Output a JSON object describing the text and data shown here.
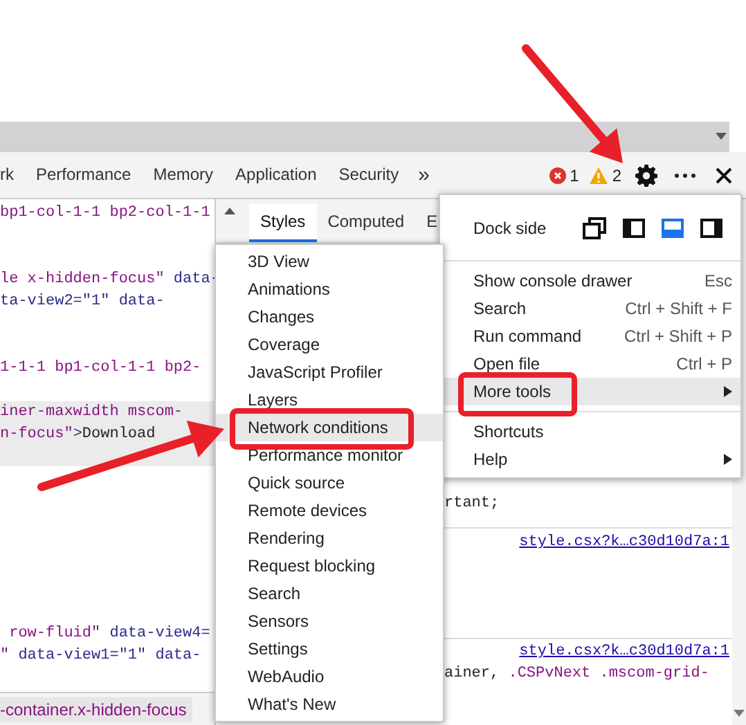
{
  "tabs": [
    {
      "label": "rk",
      "selected": false
    },
    {
      "label": "Performance",
      "selected": false
    },
    {
      "label": "Memory",
      "selected": false
    },
    {
      "label": "Application",
      "selected": false
    },
    {
      "label": "Security",
      "selected": false
    }
  ],
  "more_tabs": "»",
  "counters": {
    "errors": "1",
    "warnings": "2"
  },
  "elements": {
    "lines": [
      {
        "selected": false,
        "parts": [
          {
            "kind": "value",
            "text": "bp1-col-1-1 bp2-col-1-1"
          }
        ]
      },
      {
        "selected": false,
        "parts": [
          {
            "kind": "value",
            "text": "le x-hidden-focus\""
          },
          {
            "kind": "attr",
            "text": " data-"
          }
        ]
      },
      {
        "selected": false,
        "parts": [
          {
            "kind": "attr",
            "text": "ta-view2=\"1\" data-"
          }
        ]
      },
      {
        "selected": false,
        "parts": [
          {
            "kind": "value",
            "text": "1-1-1 bp1-col-1-1 bp2-"
          }
        ]
      },
      {
        "selected": true,
        "parts": [
          {
            "kind": "value",
            "text": "iner-maxwidth mscom-"
          }
        ]
      },
      {
        "selected": true,
        "parts": [
          {
            "kind": "value",
            "text": "n-focus\""
          },
          {
            "kind": "attr",
            "text": ">"
          },
          {
            "kind": "text",
            "text": "Download"
          }
        ]
      },
      {
        "selected": false,
        "parts": [
          {
            "kind": "value",
            "text": " row-fluid\""
          },
          {
            "kind": "attr",
            "text": " data-view4="
          }
        ]
      },
      {
        "selected": false,
        "parts": [
          {
            "kind": "value",
            "text": "\""
          },
          {
            "kind": "attr",
            "text": " data-view1=\"1\" data-"
          }
        ]
      }
    ],
    "breadcrumb": "-container.x-hidden-focus"
  },
  "styles_tabs": [
    {
      "label": "Styles",
      "selected": true
    },
    {
      "label": "Computed",
      "selected": false
    },
    {
      "label": "E",
      "selected": false
    }
  ],
  "styles": {
    "fragment": "rtant;",
    "links": [
      "style.csx?k…c30d10d7a:1",
      "style.csx?k…c30d10d7a:1"
    ],
    "selector_start": "ainer, ",
    "selector": ".CSPvNext .mscom-grid-"
  },
  "main_menu": {
    "dock_label": "Dock side",
    "dock_options": [
      {
        "kind": "undock",
        "selected": false
      },
      {
        "kind": "left",
        "selected": false
      },
      {
        "kind": "bottom",
        "selected": true
      },
      {
        "kind": "right",
        "selected": false
      }
    ],
    "sections": [
      [
        {
          "label": "Show console drawer",
          "shortcut": "Esc",
          "submenu": false,
          "highlighted": false
        },
        {
          "label": "Search",
          "shortcut": "Ctrl + Shift + F",
          "submenu": false,
          "highlighted": false
        },
        {
          "label": "Run command",
          "shortcut": "Ctrl + Shift + P",
          "submenu": false,
          "highlighted": false
        },
        {
          "label": "Open file",
          "shortcut": "Ctrl + P",
          "submenu": false,
          "highlighted": false
        },
        {
          "label": "More tools",
          "submenu": true,
          "highlighted": true
        }
      ],
      [
        {
          "label": "Shortcuts",
          "submenu": false,
          "highlighted": false
        },
        {
          "label": "Help",
          "submenu": true,
          "highlighted": false
        }
      ]
    ]
  },
  "more_tools_menu": [
    {
      "label": "3D View",
      "highlighted": false
    },
    {
      "label": "Animations",
      "highlighted": false
    },
    {
      "label": "Changes",
      "highlighted": false
    },
    {
      "label": "Coverage",
      "highlighted": false
    },
    {
      "label": "JavaScript Profiler",
      "highlighted": false
    },
    {
      "label": "Layers",
      "highlighted": false
    },
    {
      "label": "Network conditions",
      "highlighted": true
    },
    {
      "label": "Performance monitor",
      "highlighted": false
    },
    {
      "label": "Quick source",
      "highlighted": false
    },
    {
      "label": "Remote devices",
      "highlighted": false
    },
    {
      "label": "Rendering",
      "highlighted": false
    },
    {
      "label": "Request blocking",
      "highlighted": false
    },
    {
      "label": "Search",
      "highlighted": false
    },
    {
      "label": "Sensors",
      "highlighted": false
    },
    {
      "label": "Settings",
      "highlighted": false
    },
    {
      "label": "WebAudio",
      "highlighted": false
    },
    {
      "label": "What's New",
      "highlighted": false
    }
  ]
}
